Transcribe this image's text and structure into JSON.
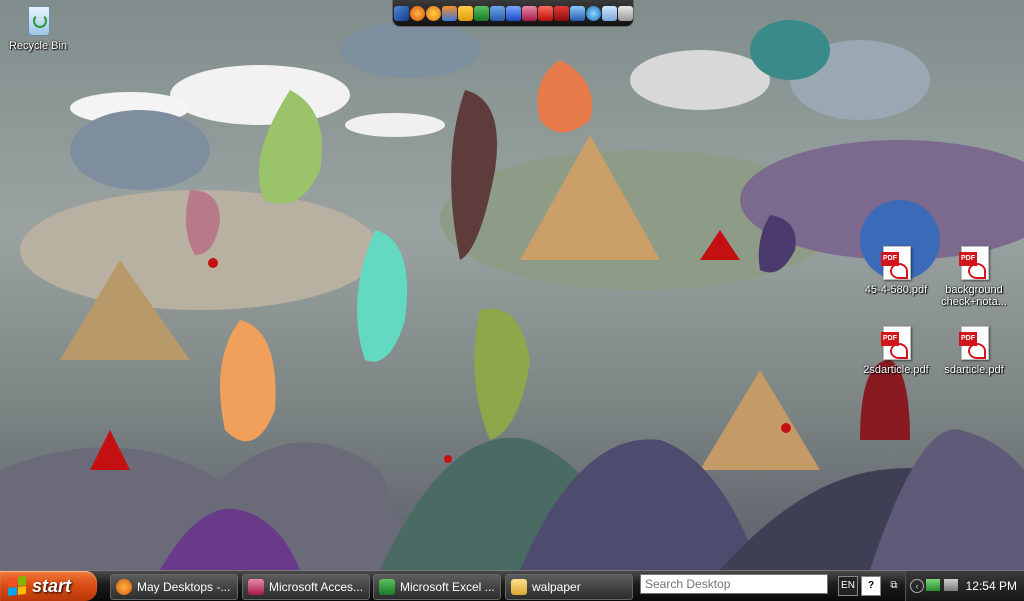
{
  "desktop": {
    "icons": [
      {
        "label": "Recycle Bin"
      },
      {
        "label": "45-4-580.pdf"
      },
      {
        "label": "background check+nota..."
      },
      {
        "label": "2sdarticle.pdf"
      },
      {
        "label": "sdarticle.pdf"
      }
    ],
    "pdf_badge": "PDF"
  },
  "dock": {
    "icons": [
      "arrow-icon",
      "firefox-icon",
      "flower-icon",
      "bird-icon",
      "runner-icon",
      "excel-icon",
      "outlook-icon",
      "word-icon",
      "access-icon",
      "acrobat-icon",
      "reader-icon",
      "photoshop-icon",
      "globe-icon",
      "notepad-icon",
      "trash-icon"
    ]
  },
  "taskbar": {
    "start_label": "start",
    "tasks": [
      {
        "label": "May Desktops -..."
      },
      {
        "label": "Microsoft Acces..."
      },
      {
        "label": "Microsoft Excel ..."
      },
      {
        "label": "walpaper"
      }
    ],
    "search_placeholder": "Search Desktop",
    "lang": "EN",
    "help": "?",
    "clock": "12:54 PM"
  },
  "colors": {
    "start": "#d84a12",
    "pdf_red": "#d2161c"
  }
}
